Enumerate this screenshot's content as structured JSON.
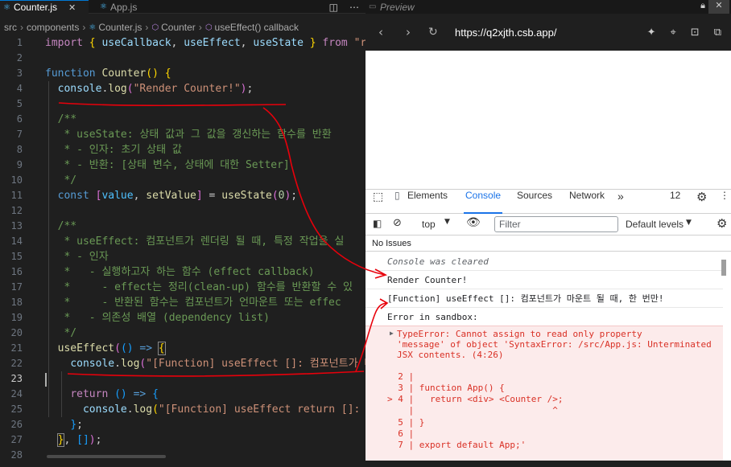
{
  "editor": {
    "tabs": [
      {
        "label": "Counter.js",
        "icon": "react-icon",
        "active": true
      },
      {
        "label": "App.js",
        "icon": "react-icon",
        "active": false
      }
    ],
    "breadcrumb": [
      "src",
      "components",
      "Counter.js",
      "Counter",
      "useEffect() callback"
    ],
    "current_line": "23"
  },
  "preview": {
    "title": "Preview",
    "url": "https://q2xjth.csb.app/"
  },
  "devtools": {
    "tabs": [
      "Elements",
      "Console",
      "Sources",
      "Network"
    ],
    "active_tab": "Console",
    "more": "»",
    "issue_count": "12",
    "context": "top",
    "filter_placeholder": "Filter",
    "levels": "Default levels",
    "issues": "No Issues",
    "logs": {
      "cleared": "Console was cleared",
      "render": "Render Counter!",
      "effect": "[Function] useEffect []: 컴포넌트가 마운트 될 때, 한 번만!",
      "sandbox": "Error in sandbox:",
      "error": "TypeError: Cannot assign to read only property\n'message' of object 'SyntaxError: /src/App.js: Unterminated\nJSX contents. (4:26)",
      "frame": [
        "  2 |",
        "  3 | function App() {",
        "> 4 |   return <div> <Counter />;",
        "    |                          ^",
        "  5 | }",
        "  6 |",
        "  7 | export default App;'"
      ]
    }
  },
  "colors": {
    "accent": "#1a73e8",
    "annotation": "#e8000b",
    "error": "#d93025"
  }
}
